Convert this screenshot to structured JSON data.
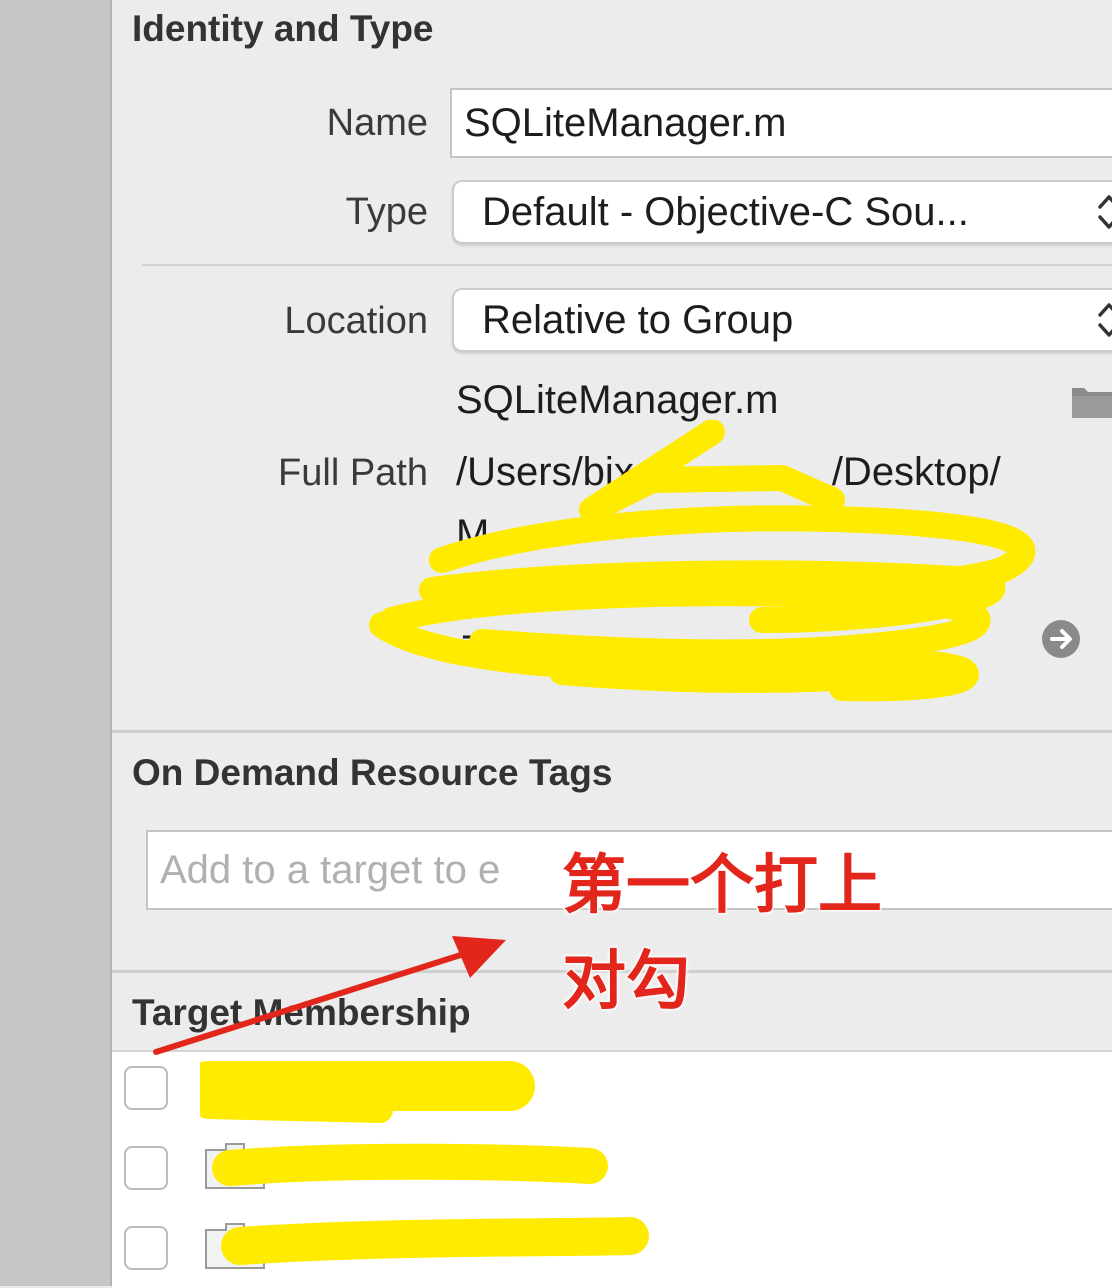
{
  "identity_section": {
    "title": "Identity and Type",
    "name_label": "Name",
    "name_value": "SQLiteManager.m",
    "type_label": "Type",
    "type_value": "Default - Objective-C Sou...",
    "location_label": "Location",
    "location_value": "Relative to Group",
    "relative_filename": "SQLiteManager.m",
    "full_path_label": "Full Path",
    "full_path_visible": "/Users/bix",
    "full_path_visible_2": "/Desktop/"
  },
  "odr_section": {
    "title": "On Demand Resource Tags",
    "tags_placeholder": "Add to a target to e"
  },
  "target_section": {
    "title": "Target Membership",
    "targets": [
      {
        "checked": false,
        "icon": "app-target-icon"
      },
      {
        "checked": false,
        "icon": "test-bundle-icon"
      },
      {
        "checked": false,
        "icon": "test-bundle-icon"
      }
    ]
  },
  "annotation": {
    "line1": "第一个打上",
    "line2": "对勾",
    "color": "#e3261b"
  },
  "colors": {
    "panel_bg": "#ececec",
    "redaction": "#ffeb00",
    "annotation_red": "#e3261b"
  }
}
